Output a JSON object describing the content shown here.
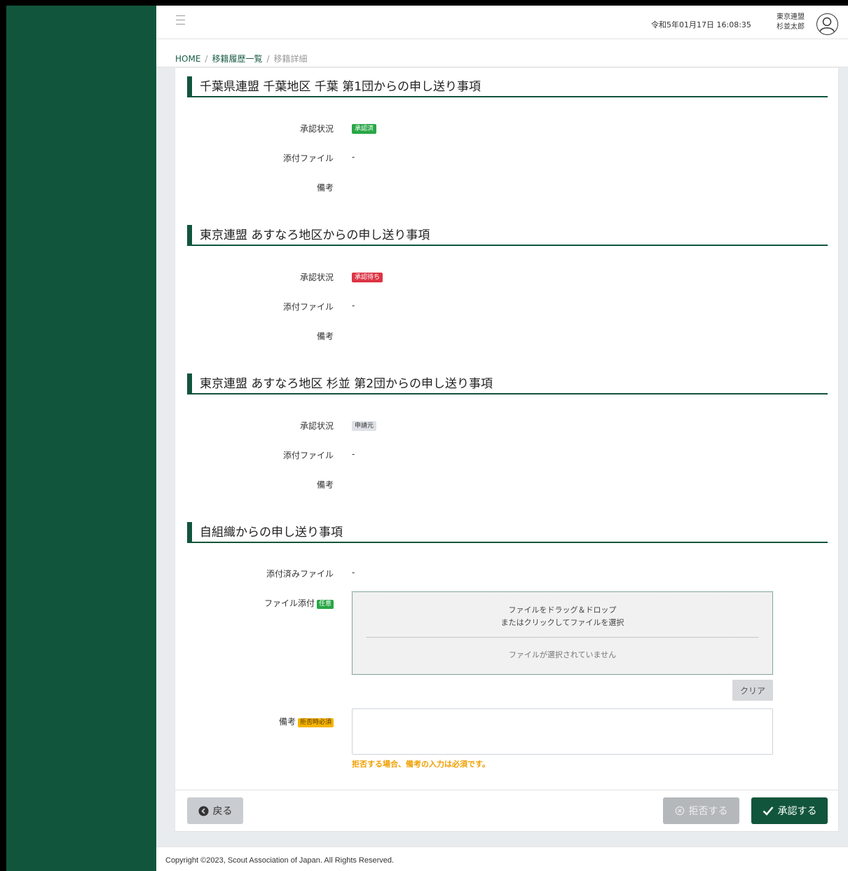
{
  "header": {
    "datetime": "令和5年01月17日 16:08:35",
    "org": "東京連盟",
    "user": "杉並太郎"
  },
  "breadcrumb": {
    "home": "HOME",
    "list": "移籍履歴一覧",
    "current": "移籍詳細",
    "sep": "/"
  },
  "sections": [
    {
      "title": "千葉県連盟 千葉地区 千葉 第1団からの申し送り事項",
      "status_label": "承認状況",
      "status": "承認済",
      "file_label": "添付ファイル",
      "file_value": "-",
      "note_label": "備考"
    },
    {
      "title": "東京連盟 あすなろ地区からの申し送り事項",
      "status_label": "承認状況",
      "status": "承認待ち",
      "file_label": "添付ファイル",
      "file_value": "-",
      "note_label": "備考"
    },
    {
      "title": "東京連盟 あすなろ地区 杉並 第2団からの申し送り事項",
      "status_label": "承認状況",
      "status": "申請元",
      "file_label": "添付ファイル",
      "file_value": "-",
      "note_label": "備考"
    }
  ],
  "own": {
    "title": "自組織からの申し送り事項",
    "attached_label": "添付済みファイル",
    "attached_value": "-",
    "attach_label": "ファイル添付",
    "attach_tag": "任意",
    "drop_line1": "ファイルをドラッグ＆ドロップ",
    "drop_line2": "またはクリックしてファイルを選択",
    "no_file": "ファイルが選択されていません",
    "clear": "クリア",
    "note_label": "備考",
    "note_tag": "拒否時必須",
    "note_value": "",
    "warning": "拒否する場合、備考の入力は必須です。"
  },
  "actions": {
    "back": "戻る",
    "reject": "拒否する",
    "approve": "承認する"
  },
  "footer": {
    "copyright": "Copyright ©2023, Scout Association of Japan. All Rights Reserved."
  },
  "colors": {
    "brand": "#11553c",
    "approved": "#28a745",
    "pending": "#dc3545",
    "warning": "#f0a000"
  }
}
